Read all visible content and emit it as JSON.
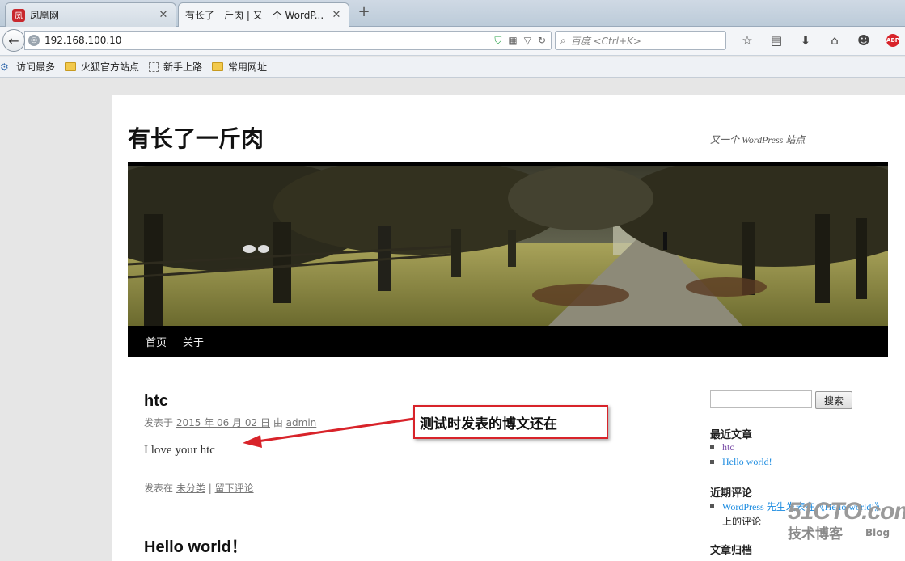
{
  "tabs": [
    {
      "label": "凤凰网",
      "favicon": "凤",
      "active": false
    },
    {
      "label": "有长了一斤肉 | 又一个 WordP...",
      "active": true
    }
  ],
  "new_tab_symbol": "+",
  "nav": {
    "url": "192.168.100.10",
    "search_placeholder": "百度 <Ctrl+K>"
  },
  "bookmarks": [
    "访问最多",
    "火狐官方站点",
    "新手上路",
    "常用网址"
  ],
  "site": {
    "title": "有长了一斤肉",
    "tagline": "又一个 WordPress 站点",
    "menu": [
      "首页",
      "关于"
    ]
  },
  "posts": [
    {
      "title": "htc",
      "meta_prefix": "发表于",
      "date": "2015 年 06 月 02 日",
      "meta_by": "由",
      "author": "admin",
      "body": "I love your htc",
      "footer_prefix": "发表在",
      "category": "未分类",
      "separator": "|",
      "comment_link": "留下评论"
    },
    {
      "title": "Hello world！"
    }
  ],
  "sidebar": {
    "search_button": "搜索",
    "recent_posts_heading": "最近文章",
    "recent_posts": [
      "htc",
      "Hello world!"
    ],
    "recent_comments_heading": "近期评论",
    "recent_comment_author": "WordPress 先生",
    "recent_comment_on": "发表在《Hello world!》",
    "recent_comment_line2": "上的评论",
    "archives_heading": "文章归档"
  },
  "annotation": {
    "text": "测试时发表的博文还在"
  },
  "watermark": {
    "line1": "51CTO.com",
    "line2": "技术博客",
    "line3": "Blog"
  },
  "colors": {
    "link": "#1b8be0",
    "visited": "#7b4fa8",
    "callout_border": "#d8232a"
  }
}
